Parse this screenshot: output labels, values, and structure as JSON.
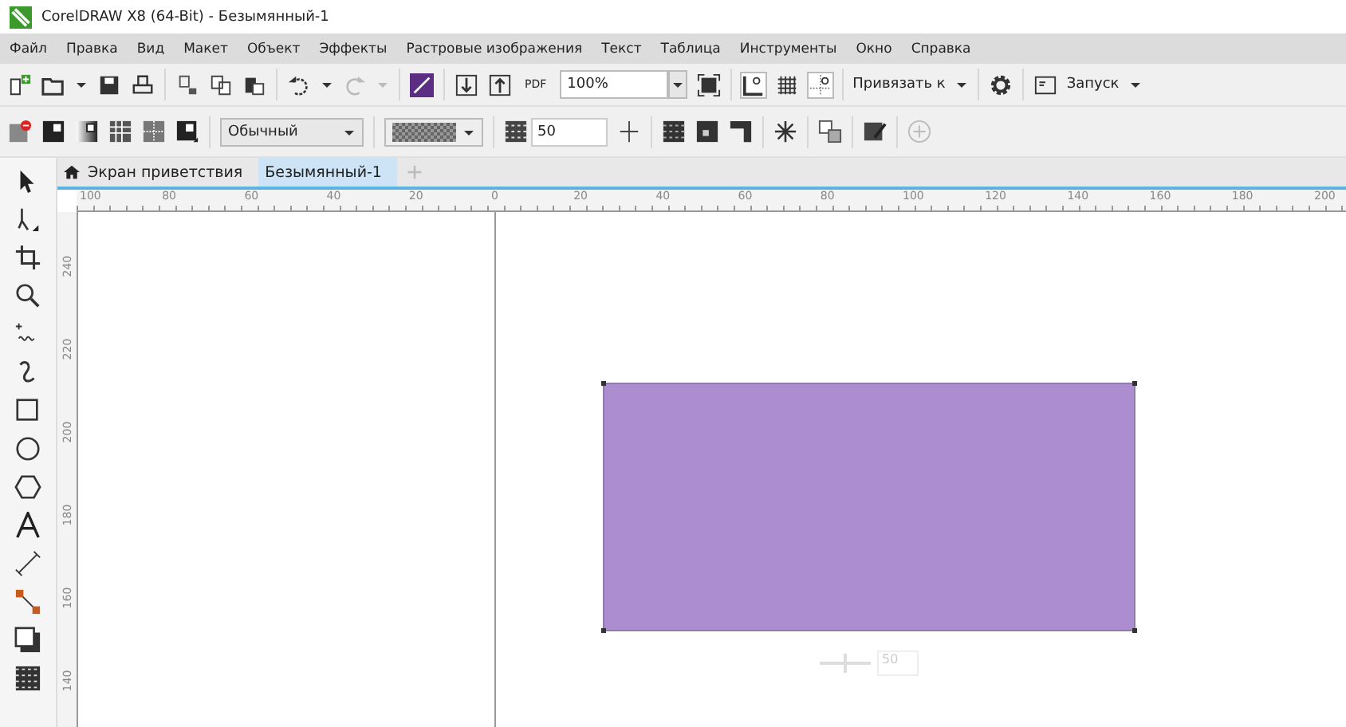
{
  "window": {
    "title": "CorelDRAW X8 (64-Bit) - Безымянный-1"
  },
  "menu": [
    "Файл",
    "Правка",
    "Вид",
    "Макет",
    "Объект",
    "Эффекты",
    "Растровые изображения",
    "Текст",
    "Таблица",
    "Инструменты",
    "Окно",
    "Справка"
  ],
  "standard_toolbar": {
    "pdf_label": "PDF",
    "zoom": "100%",
    "snap_label": "Привязать к",
    "launch_label": "Запуск",
    "redo_disabled": true
  },
  "property_bar": {
    "merge_mode": "Обычный",
    "transparency": "50"
  },
  "tabs": [
    {
      "label": "Экран приветствия",
      "kind": "home",
      "selected": false
    },
    {
      "label": "Безымянный-1",
      "kind": "doc",
      "selected": true
    }
  ],
  "ruler": {
    "horizontal": [
      "100",
      "80",
      "60",
      "40",
      "20",
      "0",
      "20",
      "40",
      "60",
      "80",
      "100",
      "120",
      "140",
      "160",
      "180",
      "200"
    ],
    "vertical": [
      "240",
      "220",
      "200",
      "180",
      "160",
      "140"
    ]
  },
  "shape": {
    "kind": "rectangle",
    "color": "#ab8dd0"
  },
  "floating_control": {
    "value": "50"
  }
}
